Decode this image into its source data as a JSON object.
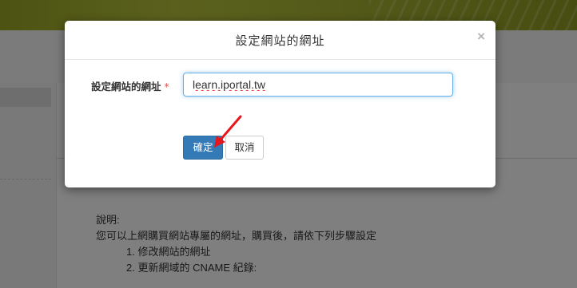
{
  "modal": {
    "title": "設定網站的網址",
    "close_label": "×",
    "field_label": "設定網站的網址",
    "required_mark": "*",
    "url_value": "learn.iportal.tw",
    "confirm_label": "確定",
    "cancel_label": "取消"
  },
  "background": {
    "note_heading": "說明:",
    "note_intro": "您可以上網購買網站專屬的網址，購買後，請依下列步驟設定",
    "steps": [
      "1. 修改網站的網址",
      "2. 更新網域的 CNAME 紀錄:"
    ]
  },
  "annotation": {
    "arrow_color": "#e8151b"
  },
  "colors": {
    "primary": "#337ab7",
    "required": "#d9534f"
  }
}
